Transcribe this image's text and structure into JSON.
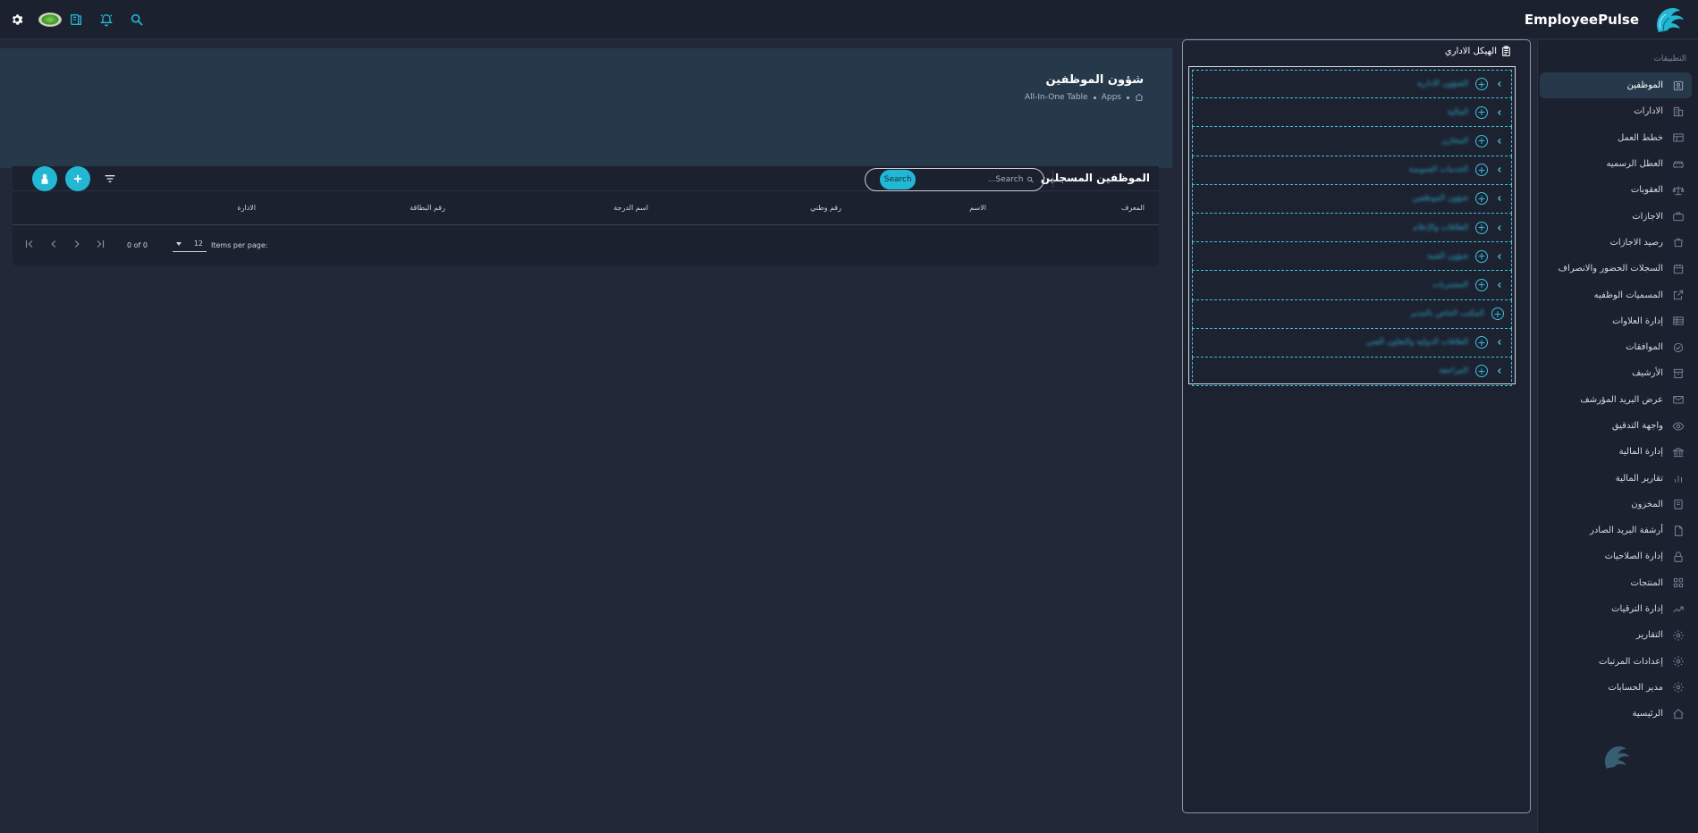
{
  "app": {
    "brand_name": "EmployeePulse"
  },
  "topbar": {
    "icons": [
      "gear-icon",
      "language-flag",
      "book-icon",
      "bell-icon",
      "search-icon"
    ]
  },
  "sidebar": {
    "section_label": "التطبيقات",
    "items": [
      {
        "label": "الموظفين",
        "icon": "badge-icon",
        "active": true
      },
      {
        "label": "الادارات",
        "icon": "building-icon"
      },
      {
        "label": "خطط العمل",
        "icon": "layout-icon"
      },
      {
        "label": "العطل الرسميه",
        "icon": "sofa-icon"
      },
      {
        "label": "العقوبات",
        "icon": "scale-icon"
      },
      {
        "label": "الاجازات",
        "icon": "suitcase-icon"
      },
      {
        "label": "رصيد الاجازات",
        "icon": "bag-icon"
      },
      {
        "label": "السجلات الحضور والانصراف",
        "icon": "calendar-icon"
      },
      {
        "label": "المسميات الوظفيه",
        "icon": "external-icon"
      },
      {
        "label": "إدارة العلاوات",
        "icon": "table-icon"
      },
      {
        "label": "الموافقات",
        "icon": "check-circle-icon"
      },
      {
        "label": "الأرشيف",
        "icon": "archive-icon"
      },
      {
        "label": "عرض البريد المؤرشف",
        "icon": "mail-icon"
      },
      {
        "label": "واجهة التدقيق",
        "icon": "eye-icon"
      },
      {
        "label": "إدارة المالية",
        "icon": "bank-icon"
      },
      {
        "label": "تقارير المالية",
        "icon": "bar-chart-icon"
      },
      {
        "label": "المخزون",
        "icon": "clipboard-icon"
      },
      {
        "label": "أرشفة البريد الصادر",
        "icon": "file-icon"
      },
      {
        "label": "إدارة الصلاحيات",
        "icon": "lock-icon"
      },
      {
        "label": "المنتجات",
        "icon": "grid-icon"
      },
      {
        "label": "إدارة الترقيات",
        "icon": "trend-icon"
      },
      {
        "label": "التقارير",
        "icon": "gear-outline-icon"
      },
      {
        "label": "إعدادات المرتبات",
        "icon": "gear-outline-icon"
      },
      {
        "label": "مدير الحسابات",
        "icon": "gear-outline-icon"
      },
      {
        "label": "الرئيسية",
        "icon": "home-icon"
      }
    ]
  },
  "org_panel": {
    "title": "الهيكل الاداري",
    "nodes": [
      {
        "label": "الشؤون الادارية",
        "expandable": true
      },
      {
        "label": "المالية",
        "expandable": true
      },
      {
        "label": "المخازن",
        "expandable": true
      },
      {
        "label": "الخدمات العمومية",
        "expandable": true
      },
      {
        "label": "شؤون الموظفين",
        "expandable": true
      },
      {
        "label": "العلاقات والإعلام",
        "expandable": true
      },
      {
        "label": "شؤون الفنية",
        "expandable": true
      },
      {
        "label": "المشتريات",
        "expandable": true
      },
      {
        "label": "المكتب الخاص بالمدير",
        "expandable": false
      },
      {
        "label": "العلاقات الدولية والتعاون الفني",
        "expandable": true
      },
      {
        "label": "المراجعة",
        "expandable": true
      }
    ]
  },
  "page_header": {
    "title": "شؤون الموظفين",
    "breadcrumb": [
      "Apps",
      "All-In-One Table"
    ]
  },
  "table": {
    "title": "الموظفين المسجلين",
    "search": {
      "placeholder": "Search...",
      "button": "Search"
    },
    "columns": [
      "المعرف",
      "الاسم",
      "رقم وطني",
      "اسم الدرجة",
      "رقم البطاقة",
      "الادارة"
    ],
    "paginator": {
      "items_per_page_label": "Items per page:",
      "page_size": "12",
      "range_label": "0 of 0"
    }
  },
  "colors": {
    "accent": "#22b8d4",
    "background": "#222838",
    "surface": "#1c2130",
    "header": "#26394b"
  }
}
